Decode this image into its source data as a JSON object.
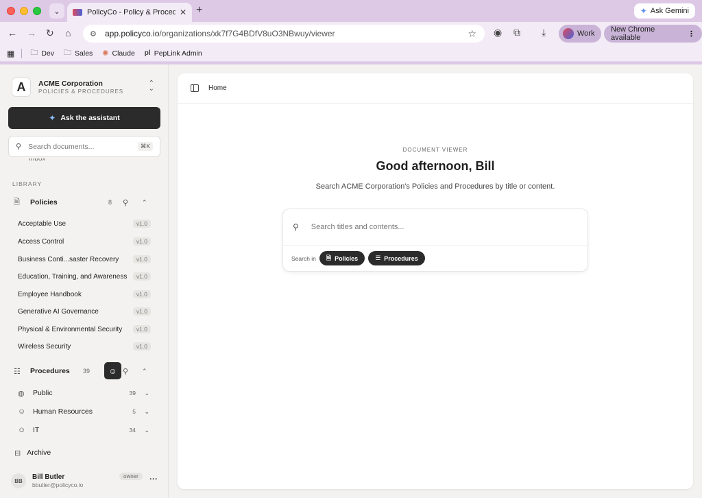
{
  "browser": {
    "tab_title": "PolicyCo - Policy & Procedures",
    "ask_gemini": "Ask Gemini",
    "url_domain": "app.policyco.io",
    "url_path": "/organizations/xk7f7G4BDfV8uO3NBwuy/viewer",
    "profile": "Work",
    "update": "New Chrome available",
    "bookmarks": [
      {
        "label": "Dev",
        "icon": "folder-icon"
      },
      {
        "label": "Sales",
        "icon": "folder-icon"
      },
      {
        "label": "Claude",
        "icon": "claude-icon"
      },
      {
        "label": "PepLink Admin",
        "icon": "peplink-icon"
      }
    ]
  },
  "sidebar": {
    "org_logo": "A",
    "org_name": "ACME Corporation",
    "org_sub": "POLICIES & PROCEDURES",
    "ask_label": "Ask the assistant",
    "search_placeholder": "Search documents...",
    "search_kbd": "⌘K",
    "inbox_partial": "Inbox",
    "library_label": "LIBRARY",
    "policies": {
      "label": "Policies",
      "count": "8",
      "items": [
        {
          "name": "Acceptable Use",
          "version": "v1.0"
        },
        {
          "name": "Access Control",
          "version": "v1.0"
        },
        {
          "name": "Business Conti...saster Recovery",
          "version": "v1.0"
        },
        {
          "name": "Education, Training, and Awareness",
          "version": "v1.0"
        },
        {
          "name": "Employee Handbook",
          "version": "v1.0"
        },
        {
          "name": "Generative AI Governance",
          "version": "v1.0"
        },
        {
          "name": "Physical & Environmental Security",
          "version": "v1.0"
        },
        {
          "name": "Wireless Security",
          "version": "v1.0"
        }
      ]
    },
    "procedures": {
      "label": "Procedures",
      "count": "39",
      "groups": [
        {
          "name": "Public",
          "count": "39",
          "icon": "globe-icon"
        },
        {
          "name": "Human Resources",
          "count": "5",
          "icon": "face-icon"
        },
        {
          "name": "IT",
          "count": "34",
          "icon": "face-icon"
        }
      ]
    },
    "archive_label": "Archive",
    "user": {
      "initials": "BB",
      "name": "Bill Butler",
      "email": "bbutler@policyco.io",
      "role": "owner"
    }
  },
  "main": {
    "breadcrumb": "Home",
    "eyebrow": "DOCUMENT VIEWER",
    "greeting": "Good afternoon, Bill",
    "subtitle": "Search ACME Corporation's Policies and Procedures by title or content.",
    "search_placeholder": "Search titles and contents...",
    "search_in_label": "Search in",
    "filters": [
      {
        "label": "Policies",
        "icon": "document-icon"
      },
      {
        "label": "Procedures",
        "icon": "list-icon"
      }
    ]
  }
}
